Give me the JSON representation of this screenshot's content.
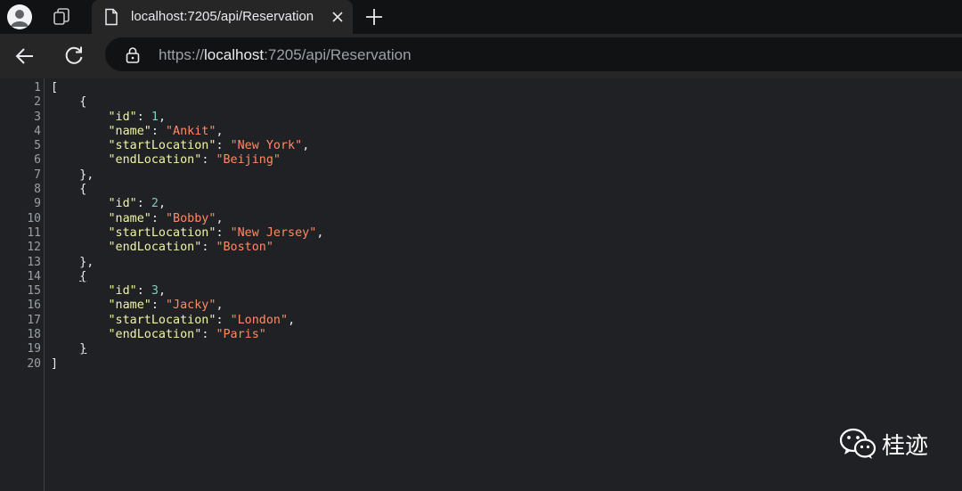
{
  "tab": {
    "title": "localhost:7205/api/Reservation"
  },
  "address_bar": {
    "scheme": "https://",
    "host": "localhost",
    "rest": ":7205/api/Reservation"
  },
  "gutter": [
    "1",
    "2",
    "3",
    "4",
    "5",
    "6",
    "7",
    "8",
    "9",
    "10",
    "11",
    "12",
    "13",
    "14",
    "15",
    "16",
    "17",
    "18",
    "19",
    "20"
  ],
  "reservations": [
    {
      "id": "1",
      "name": "\"Ankit\"",
      "startLocation": "\"New York\"",
      "endLocation": "\"Beijing\""
    },
    {
      "id": "2",
      "name": "\"Bobby\"",
      "startLocation": "\"New Jersey\"",
      "endLocation": "\"Boston\""
    },
    {
      "id": "3",
      "name": "\"Jacky\"",
      "startLocation": "\"London\"",
      "endLocation": "\"Paris\""
    }
  ],
  "keys": {
    "id": "\"id\"",
    "name": "\"name\"",
    "startLocation": "\"startLocation\"",
    "endLocation": "\"endLocation\""
  },
  "punct": {
    "open_array": "[",
    "close_array": "]",
    "open_obj": "{",
    "close_obj": "}",
    "close_obj_comma": "},"
  },
  "watermark": {
    "text": "桂迹",
    "icon": "wechat-icon"
  },
  "colors": {
    "key": "#f1f3a8",
    "string": "#ff8a65",
    "number": "#80cbc4",
    "background": "#202124"
  }
}
